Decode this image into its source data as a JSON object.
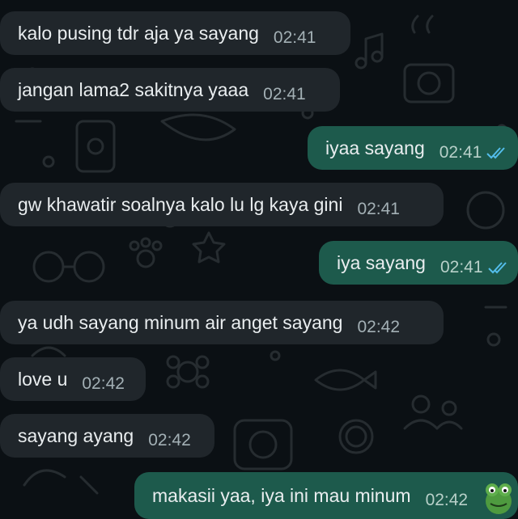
{
  "messages": [
    {
      "direction": "incoming",
      "text": "kalo pusing tdr aja ya sayang",
      "time": "02:41"
    },
    {
      "direction": "incoming",
      "text": "jangan lama2 sakitnya yaaa",
      "time": "02:41"
    },
    {
      "direction": "outgoing",
      "text": "iyaa sayang",
      "time": "02:41",
      "status": "read"
    },
    {
      "direction": "incoming",
      "text": "gw khawatir soalnya kalo lu lg kaya gini",
      "time": "02:41"
    },
    {
      "direction": "outgoing",
      "text": "iya sayang",
      "time": "02:41",
      "status": "read"
    },
    {
      "direction": "incoming",
      "text": "ya udh sayang minum air anget sayang",
      "time": "02:42"
    },
    {
      "direction": "incoming",
      "text": "love u",
      "time": "02:42"
    },
    {
      "direction": "incoming",
      "text": "sayang ayang",
      "time": "02:42"
    },
    {
      "direction": "outgoing",
      "text": "makasii yaa, iya ini mau minum",
      "time": "02:42"
    }
  ],
  "colors": {
    "background": "#0b1014",
    "incoming_bubble": "#20262b",
    "outgoing_bubble": "#1d5a4c",
    "read_ticks": "#53bdeb"
  }
}
